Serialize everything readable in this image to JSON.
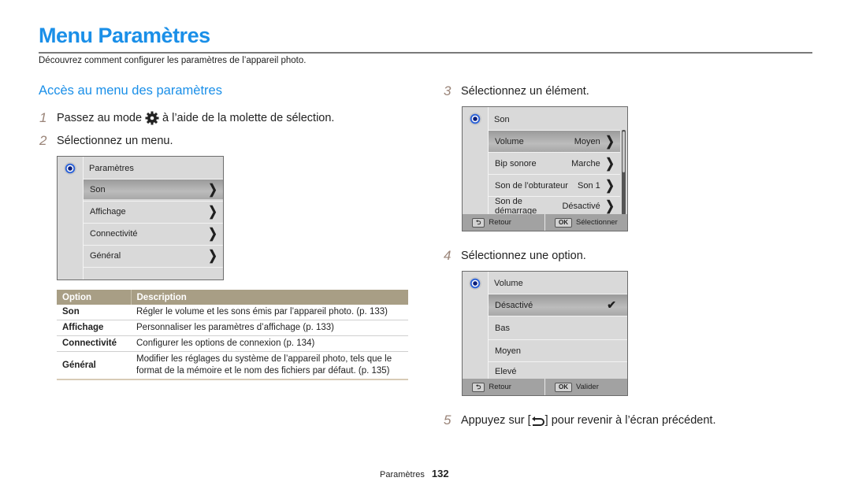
{
  "page": {
    "title": "Menu Paramètres",
    "intro": "Découvrez comment configurer les paramètres de l’appareil photo.",
    "section_title": "Accès au menu des paramètres"
  },
  "steps": [
    {
      "num": "1",
      "text_before": "Passez au mode",
      "icon": "settings-gear-icon",
      "text_after": "à l’aide de la molette de sélection."
    },
    {
      "num": "2",
      "text": "Sélectionnez un menu."
    },
    {
      "num": "3",
      "text": "Sélectionnez un élément."
    },
    {
      "num": "4",
      "text": "Sélectionnez une option."
    },
    {
      "num": "5",
      "text_before": "Appuyez sur [",
      "icon": "back-arrow-icon",
      "text_after": "] pour revenir à l’écran précédent."
    }
  ],
  "screen_menu": {
    "header": "Paramètres",
    "items": [
      {
        "label": "Son",
        "selected": true
      },
      {
        "label": "Affichage",
        "selected": false
      },
      {
        "label": "Connectivité",
        "selected": false
      },
      {
        "label": "Général",
        "selected": false
      }
    ]
  },
  "screen_items": {
    "header": "Son",
    "items": [
      {
        "label": "Volume",
        "value": "Moyen",
        "selected": true
      },
      {
        "label": "Bip sonore",
        "value": "Marche",
        "selected": false
      },
      {
        "label": "Son de l’obturateur",
        "value": "Son 1",
        "selected": false
      },
      {
        "label": "Son de démarrage",
        "value": "Désactivé",
        "selected": false
      }
    ],
    "back_key": "⮌",
    "back_label": "Retour",
    "ok_key": "OK",
    "ok_label": "Sélectionner"
  },
  "screen_options": {
    "header": "Volume",
    "items": [
      {
        "label": "Désactivé",
        "selected": true
      },
      {
        "label": "Bas",
        "selected": false
      },
      {
        "label": "Moyen",
        "selected": false
      },
      {
        "label": "Elevé",
        "selected": false
      }
    ],
    "back_key": "⮌",
    "back_label": "Retour",
    "ok_key": "OK",
    "ok_label": "Valider"
  },
  "table": {
    "headers": [
      "Option",
      "Description"
    ],
    "rows": [
      {
        "option": "Son",
        "description": "Régler le volume et les sons émis par l’appareil photo. (p. 133)"
      },
      {
        "option": "Affichage",
        "description": "Personnaliser les paramètres d’affichage (p. 133)"
      },
      {
        "option": "Connectivité",
        "description": "Configurer les options de connexion (p. 134)"
      },
      {
        "option": "Général",
        "description": "Modifier les réglages du système de l’appareil photo, tels que le format de la mémoire et le nom des fichiers par défaut. (p. 135)"
      }
    ]
  },
  "footer": {
    "section": "Paramètres",
    "page_number": "132"
  },
  "colors": {
    "title_blue": "#1a8fe8",
    "table_header": "#a89e85",
    "step_number": "#9a8478"
  }
}
